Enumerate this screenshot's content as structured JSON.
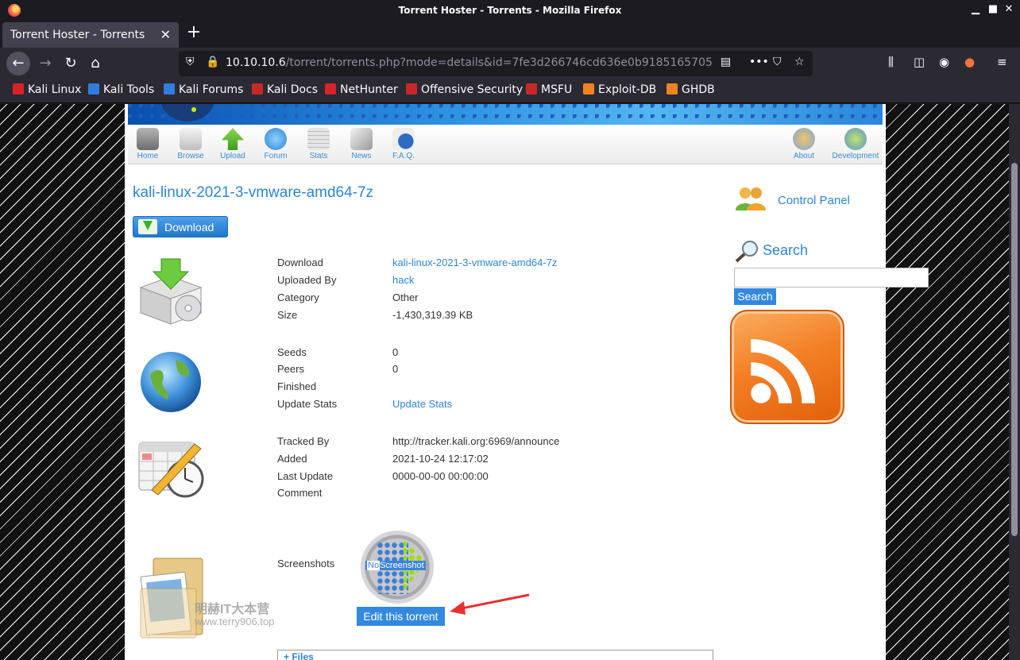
{
  "window": {
    "title": "Torrent Hoster - Torrents - Mozilla Firefox",
    "min_glyph": "▁",
    "max_glyph": "■",
    "close_glyph": "✕"
  },
  "tabs": [
    {
      "label": "Torrent Hoster - Torrents",
      "close_glyph": "✕"
    }
  ],
  "newtab_glyph": "+",
  "nav": {
    "back_glyph": "←",
    "forward_glyph": "→",
    "reload_glyph": "↻",
    "home_glyph": "⌂",
    "url_host": "10.10.10.6",
    "url_path": "/torrent/torrents.php?mode=details&id=7fe3d266746cd636e0b9185165705",
    "shield_glyph": "⛨",
    "insecure_glyph": "🔒",
    "reader_glyph": "▤",
    "more_glyph": "•••",
    "pocket_glyph": "⛉",
    "star_glyph": "☆",
    "library_glyph": "⫼",
    "sidebar_glyph": "◫",
    "account_glyph": "◉",
    "ext_glyph": "●",
    "menu_glyph": "≡"
  },
  "bookmarks": [
    {
      "label": "Kali Linux",
      "color": "#d8232a"
    },
    {
      "label": "Kali Tools",
      "color": "#2f7de1"
    },
    {
      "label": "Kali Forums",
      "color": "#2f7de1"
    },
    {
      "label": "Kali Docs",
      "color": "#c62828"
    },
    {
      "label": "NetHunter",
      "color": "#d8232a"
    },
    {
      "label": "Offensive Security",
      "color": "#c62828"
    },
    {
      "label": "MSFU",
      "color": "#c62828"
    },
    {
      "label": "Exploit-DB",
      "color": "#f58220"
    },
    {
      "label": "GHDB",
      "color": "#f58220"
    }
  ],
  "menu": {
    "left": [
      {
        "label": "Home",
        "color": "#8b8b8b"
      },
      {
        "label": "Browse",
        "color": "#c9c9c9"
      },
      {
        "label": "Upload",
        "color": "#5cb82e"
      },
      {
        "label": "Forum",
        "color": "#4aa3df"
      },
      {
        "label": "Stats",
        "color": "#b9b9b9"
      },
      {
        "label": "News",
        "color": "#a9a9a9"
      },
      {
        "label": "F.A.Q.",
        "color": "#2d6cc0"
      }
    ],
    "right": [
      {
        "label": "About",
        "color": "#d49b3a"
      },
      {
        "label": "Development",
        "color": "#5a8fd0"
      }
    ]
  },
  "torrent": {
    "title": "kali-linux-2021-3-vmware-amd64-7z",
    "download_button": "Download",
    "rows": [
      {
        "label": "Download",
        "value": "kali-linux-2021-3-vmware-amd64-7z",
        "link": true
      },
      {
        "label": "Uploaded By",
        "value": "hack",
        "link": true
      },
      {
        "label": "Category",
        "value": "Other",
        "link": false
      },
      {
        "label": "Size",
        "value": "-1,430,319.39 KB",
        "link": false
      },
      {
        "label": "Seeds",
        "value": "0",
        "link": false
      },
      {
        "label": "Peers",
        "value": "0",
        "link": false
      },
      {
        "label": "Finished",
        "value": "",
        "link": false
      },
      {
        "label": "Update Stats",
        "value": "Update Stats",
        "link": true
      },
      {
        "label": "Tracked By",
        "value": "http://tracker.kali.org:6969/announce",
        "link": false
      },
      {
        "label": "Added",
        "value": "2021-10-24 12:17:02",
        "link": false
      },
      {
        "label": "Last Update",
        "value": "0000-00-00 00:00:00",
        "link": false
      },
      {
        "label": "Comment",
        "value": "",
        "link": false
      }
    ],
    "screenshots_label": "Screenshots",
    "no_screenshot_prefix": "No",
    "no_screenshot_suffix": "Screenshot",
    "edit_button": "Edit this torrent",
    "files_label": "+ Files"
  },
  "watermark": {
    "line1": "明赫IT大本营",
    "line2": "www.terry906.top"
  },
  "sidebar": {
    "control_panel": "Control Panel",
    "search_heading": "Search",
    "search_value": "",
    "search_button": "Search"
  },
  "colors": {
    "accent": "#2d86d4",
    "button": "#3389df",
    "rss": "#f37f25",
    "arrow": "#e8302d"
  }
}
